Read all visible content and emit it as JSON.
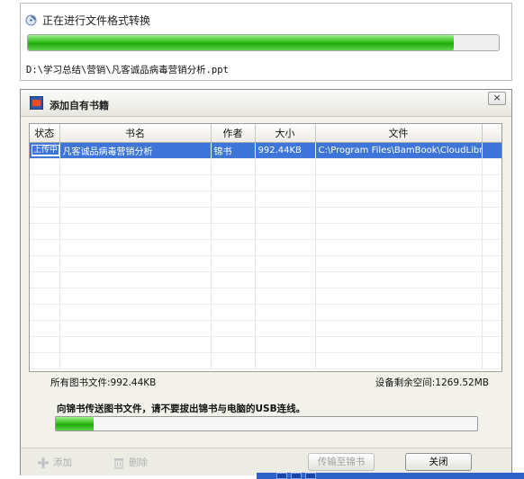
{
  "conversion": {
    "title": "正在进行文件格式转换",
    "progress": 0.904,
    "file_path": "D:\\学习总结\\营销\\凡客诚品病毒营销分析.ppt"
  },
  "dialog": {
    "title": "添加自有书籍",
    "close_label": "×",
    "columns": [
      "状态",
      "书名",
      "作者",
      "大小",
      "文件"
    ],
    "rows": [
      {
        "status": "上传中",
        "name": "凡客诚品病毒营销分析",
        "author": "锦书",
        "size": "992.44KB",
        "file": "C:\\Program Files\\BamBook\\CloudLibrar"
      }
    ],
    "total_label": "所有图书文件:992.44KB",
    "free_space_label": "设备剩余空间:1269.52MB",
    "warning": "向锦书传送图书文件，请不要拔出锦书与电脑的USB连线。",
    "transfer_progress": 0.09,
    "toolbar": {
      "add_label": "添加",
      "delete_label": "删除",
      "transfer_label": "传输至锦书",
      "close_label": "关闭"
    }
  },
  "colors": {
    "selection": "#3d75d9",
    "progress_green": "#38c21d",
    "taskbar": "#2f61c9"
  }
}
